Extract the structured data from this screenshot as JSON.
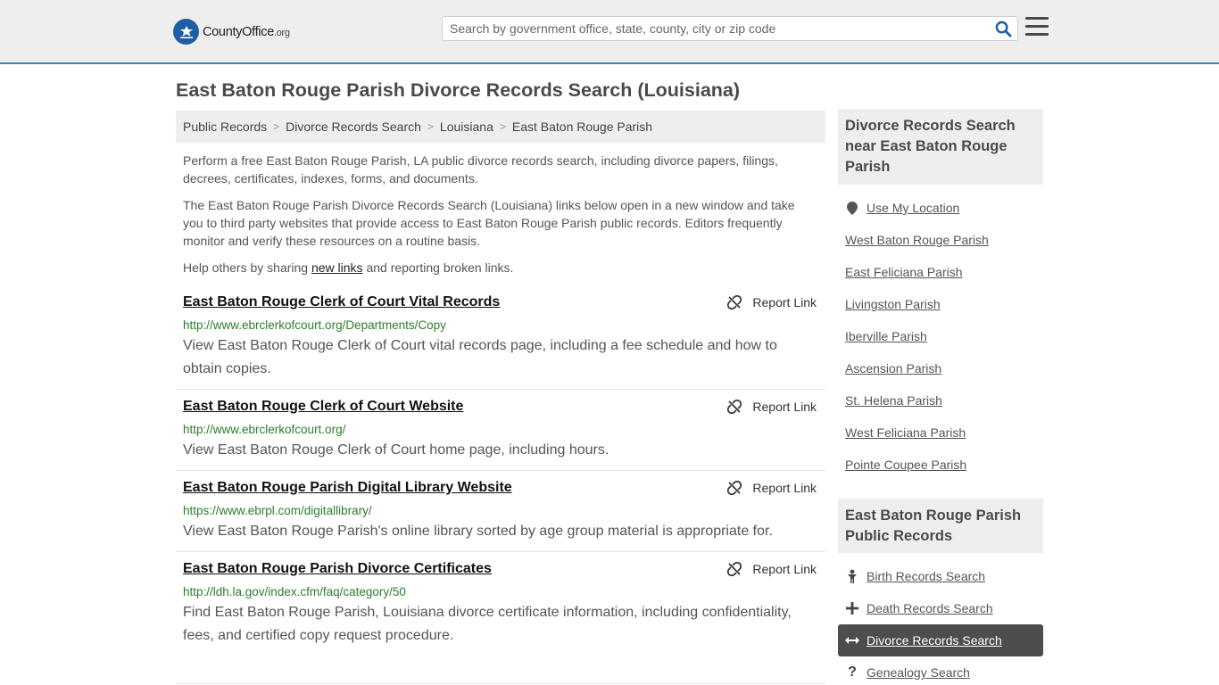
{
  "header": {
    "logo_text": "CountyOffice",
    "logo_suffix": ".org",
    "search_placeholder": "Search by government office, state, county, city or zip code"
  },
  "page_title": "East Baton Rouge Parish Divorce Records Search (Louisiana)",
  "breadcrumb": [
    "Public Records",
    "Divorce Records Search",
    "Louisiana",
    "East Baton Rouge Parish"
  ],
  "intro": {
    "p1": "Perform a free East Baton Rouge Parish, LA public divorce records search, including divorce papers, filings, decrees, certificates, indexes, forms, and documents.",
    "p2": "The East Baton Rouge Parish Divorce Records Search (Louisiana) links below open in a new window and take you to third party websites that provide access to East Baton Rouge Parish public records. Editors frequently monitor and verify these resources on a routine basis.",
    "p3_before": "Help others by sharing ",
    "p3_link": "new links",
    "p3_after": " and reporting broken links."
  },
  "report_label": "Report Link",
  "results": [
    {
      "title": "East Baton Rouge Clerk of Court Vital Records",
      "url": "http://www.ebrclerkofcourt.org/Departments/Copy",
      "desc": "View East Baton Rouge Clerk of Court vital records page, including a fee schedule and how to obtain copies."
    },
    {
      "title": "East Baton Rouge Clerk of Court Website",
      "url": "http://www.ebrclerkofcourt.org/",
      "desc": "View East Baton Rouge Clerk of Court home page, including hours."
    },
    {
      "title": "East Baton Rouge Parish Digital Library Website",
      "url": "https://www.ebrpl.com/digitallibrary/",
      "desc": "View East Baton Rouge Parish's online library sorted by age group material is appropriate for."
    },
    {
      "title": "East Baton Rouge Parish Divorce Certificates",
      "url": "http://ldh.la.gov/index.cfm/faq/category/50",
      "desc": "Find East Baton Rouge Parish, Louisiana divorce certificate information, including confidentiality, fees, and certified copy request procedure."
    }
  ],
  "sidebar": {
    "nearby_title": "Divorce Records Search near East Baton Rouge Parish",
    "use_location": "Use My Location",
    "nearby": [
      "West Baton Rouge Parish",
      "East Feliciana Parish",
      "Livingston Parish",
      "Iberville Parish",
      "Ascension Parish",
      "St. Helena Parish",
      "West Feliciana Parish",
      "Pointe Coupee Parish"
    ],
    "records_title": "East Baton Rouge Parish Public Records",
    "records": [
      {
        "label": "Birth Records Search",
        "icon": "baby-icon"
      },
      {
        "label": "Death Records Search",
        "icon": "cross-icon"
      },
      {
        "label": "Divorce Records Search",
        "icon": "arrows-horizontal-icon",
        "active": true
      },
      {
        "label": "Genealogy Search",
        "icon": "question-icon"
      }
    ]
  },
  "colors": {
    "accent": "#3b80c6",
    "url_green": "#2d7d2d",
    "active_bg": "#4d4d4d"
  }
}
